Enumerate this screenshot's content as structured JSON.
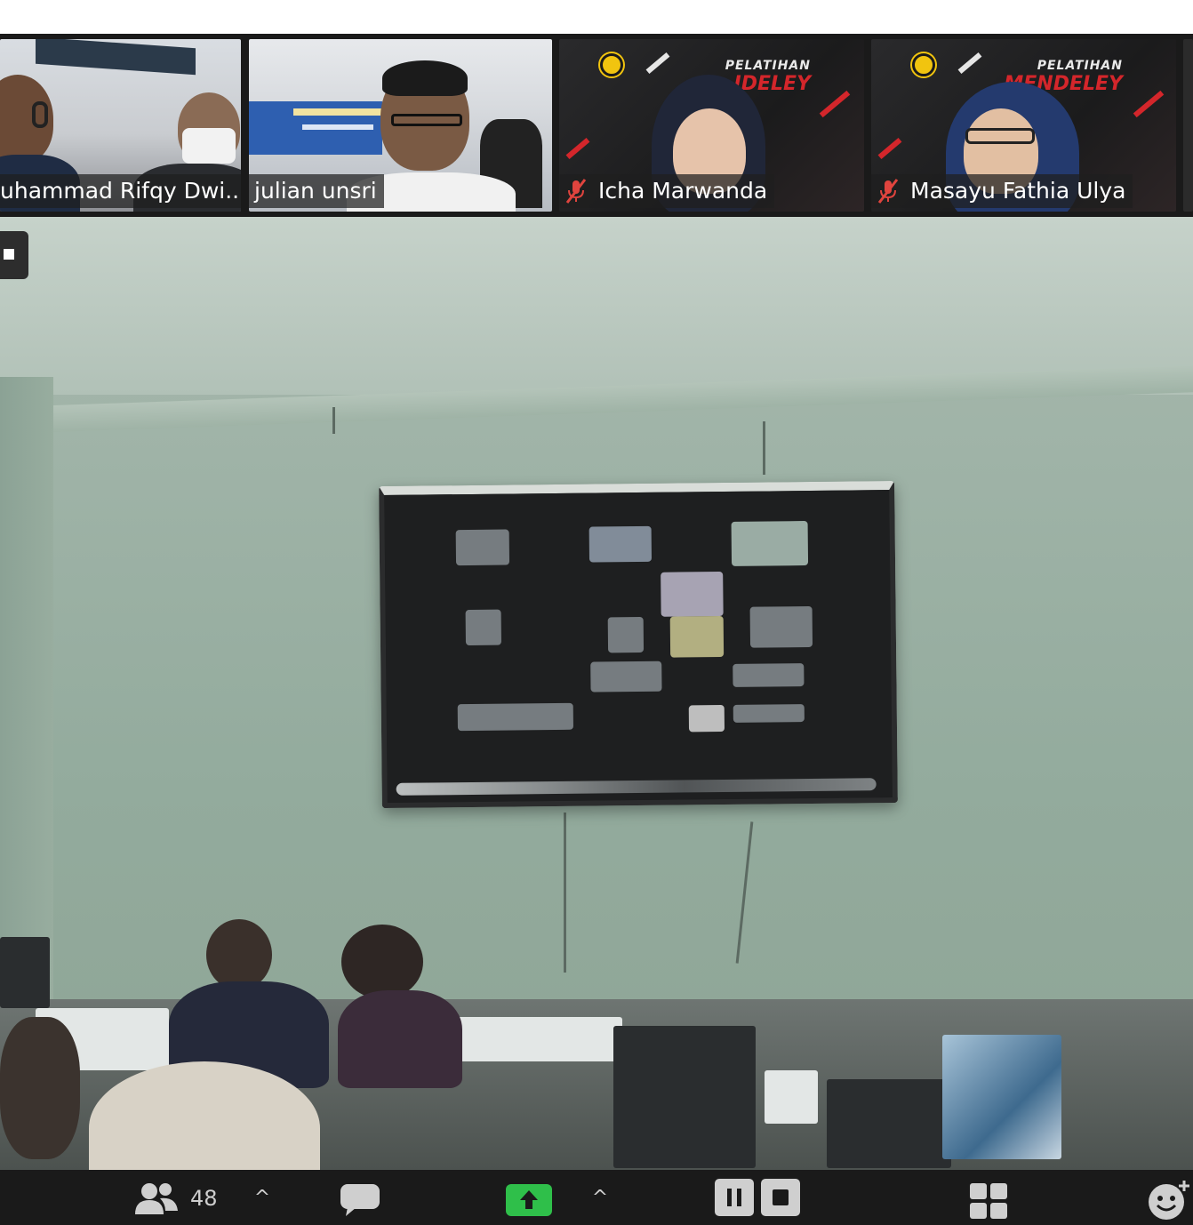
{
  "participants": [
    {
      "name": "uhammad Rifqy Dwi...",
      "muted": false
    },
    {
      "name": "julian unsri",
      "muted": false
    },
    {
      "name": "Icha Marwanda",
      "muted": true
    },
    {
      "name": "Masayu Fathia Ulya",
      "muted": true
    }
  ],
  "banner": {
    "title": "PELATIHAN",
    "subtitle_partial_3": "IDELEY",
    "subtitle_partial_4": "MENDELEY"
  },
  "toolbar": {
    "participants_count": "48",
    "chevron": "^"
  },
  "colors": {
    "share_green": "#2fbf4a",
    "mute_red": "#e0443e",
    "toolbar_bg": "#1a1a1a"
  },
  "icons": {
    "participants": "participants-icon",
    "chat": "chat-icon",
    "share_screen": "share-screen-icon",
    "pause_share": "pause-share-icon",
    "stop_share": "stop-share-icon",
    "gallery": "gallery-view-icon",
    "reactions": "reactions-icon",
    "mute": "microphone-muted-icon"
  }
}
